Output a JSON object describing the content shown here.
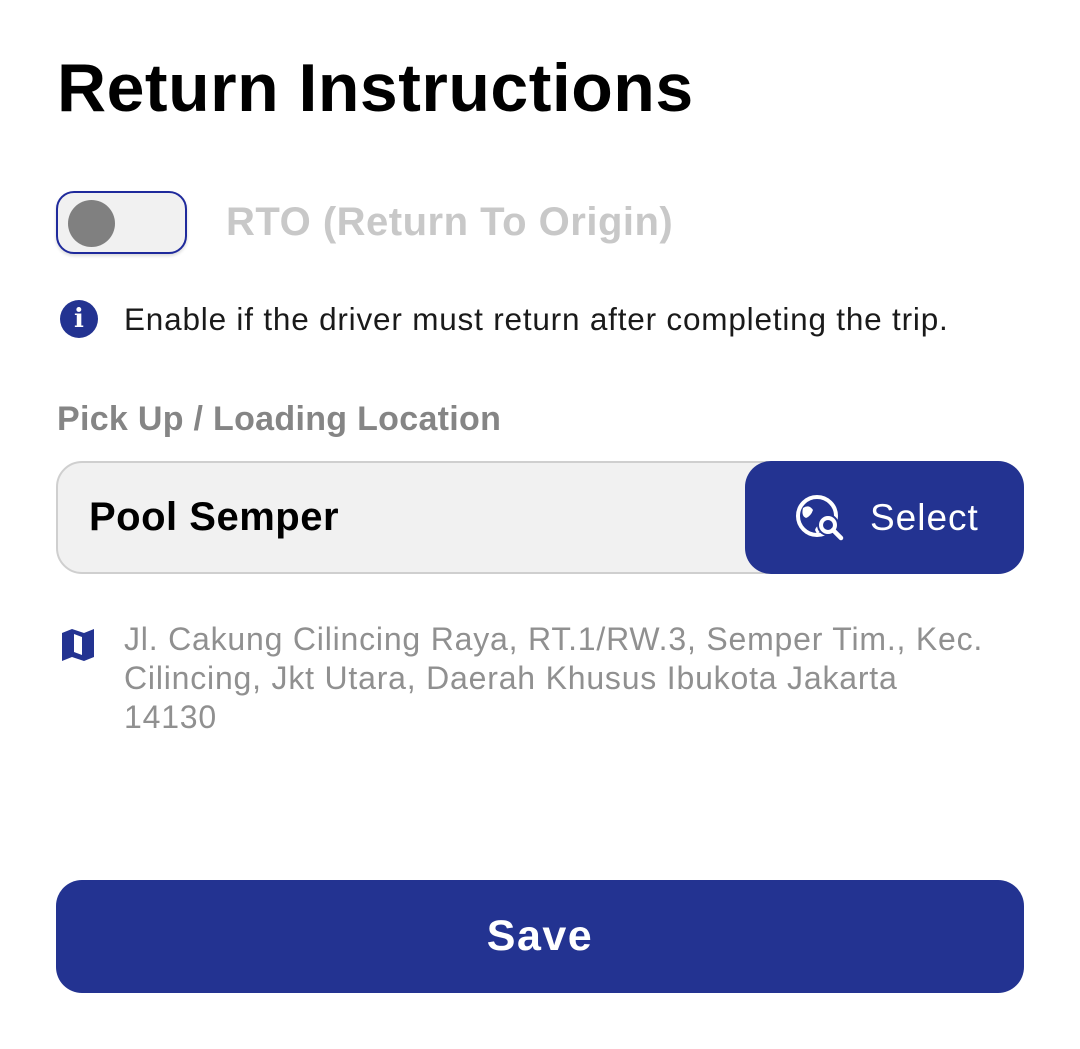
{
  "header": {
    "title": "Return Instructions"
  },
  "rto": {
    "label": "RTO (Return To Origin)",
    "enabled": false,
    "hint_icon": "info-icon",
    "hint": "Enable if the driver must return after completing the trip."
  },
  "pickup": {
    "label": "Pick Up / Loading Location",
    "value": "Pool Semper",
    "select_icon": "globe-search-icon",
    "select_label": "Select",
    "address_icon": "map-icon",
    "address": "Jl. Cakung Cilincing Raya, RT.1/RW.3, Semper Tim., Kec. Cilincing, Jkt Utara, Daerah Khusus Ibukota Jakarta 14130"
  },
  "actions": {
    "save_label": "Save"
  },
  "colors": {
    "primary": "#233391",
    "toggle_border": "#1f2a9c",
    "field_background": "#f1f1f1",
    "muted_text": "#909090"
  }
}
